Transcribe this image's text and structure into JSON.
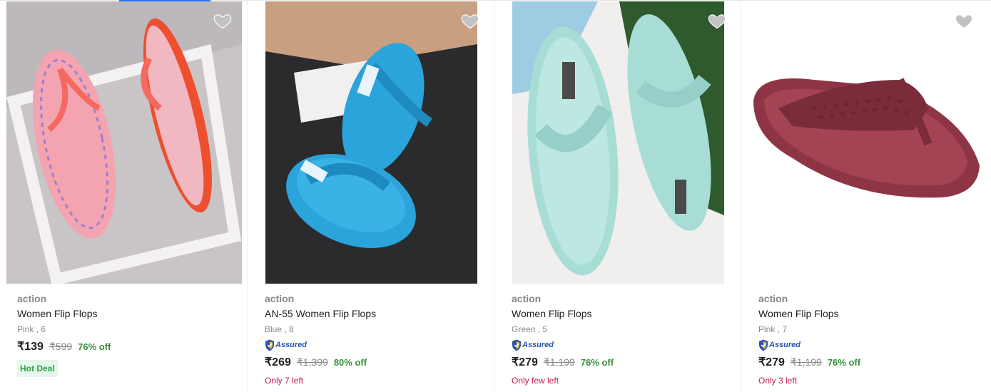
{
  "products": [
    {
      "brand": "action",
      "title": "Women Flip Flops",
      "variant": "Pink , 6",
      "assured": false,
      "price": "₹139",
      "mrp": "₹599",
      "discount": "76% off",
      "badge": "Hot Deal",
      "stock": "",
      "color": "#f08a9b"
    },
    {
      "brand": "action",
      "title": "AN-55 Women Flip Flops",
      "variant": "Blue , 8",
      "assured": true,
      "assured_label": "Assured",
      "price": "₹269",
      "mrp": "₹1,399",
      "discount": "80% off",
      "stock": "Only 7 left",
      "color": "#2aa1d9"
    },
    {
      "brand": "action",
      "title": "Women Flip Flops",
      "variant": "Green , 5",
      "assured": true,
      "assured_label": "Assured",
      "price": "₹279",
      "mrp": "₹1,199",
      "discount": "76% off",
      "stock": "Only few left",
      "color": "#a9dcd4"
    },
    {
      "brand": "action",
      "title": "Women Flip Flops",
      "variant": "Pink , 7",
      "assured": true,
      "assured_label": "Assured",
      "price": "₹279",
      "mrp": "₹1,199",
      "discount": "76% off",
      "stock": "Only 3 left",
      "color": "#8e3545"
    }
  ],
  "icons": {
    "wishlist": "heart-icon",
    "assured": "shield-icon"
  },
  "theme": {
    "discount_green": "#388e3c",
    "stock_pink": "#c2185b",
    "assured_blue": "#2a55a8",
    "deal_bg": "#e6f7ec"
  }
}
